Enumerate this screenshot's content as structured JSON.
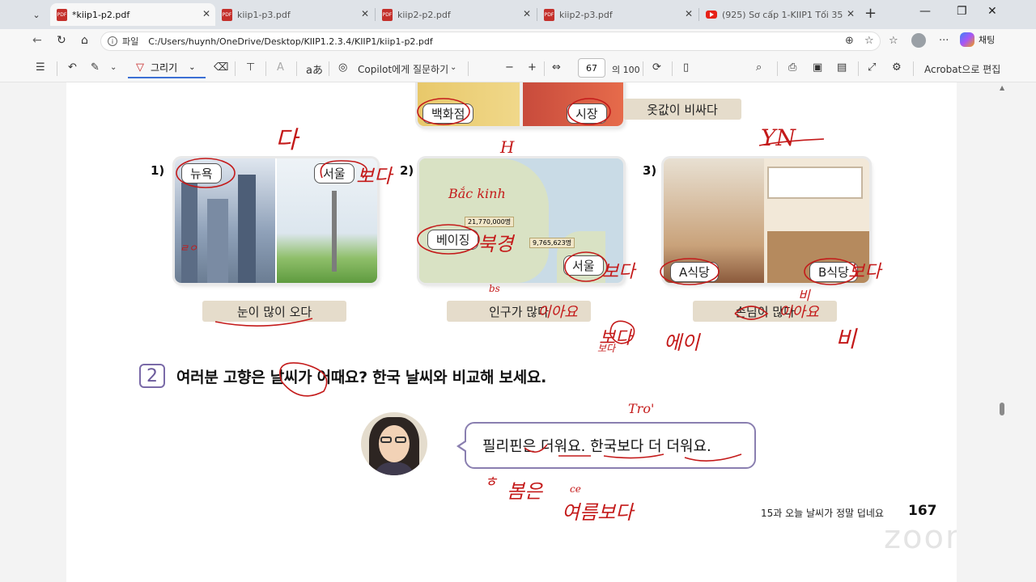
{
  "tabs": [
    {
      "title": "*kiip1-p2.pdf",
      "active": true
    },
    {
      "title": "kiip1-p3.pdf"
    },
    {
      "title": "kiip2-p2.pdf"
    },
    {
      "title": "kiip2-p3.pdf"
    },
    {
      "title": "(925) Sơ cấp 1-KIIP1 Tối 357 T12.2..."
    }
  ],
  "address": {
    "scheme_label": "파일",
    "path": "C:/Users/huynh/OneDrive/Desktop/KIIP1.2.3.4/KIIP1/kiip1-p2.pdf"
  },
  "browser": {
    "copilot_label": "채팅"
  },
  "pdf_toolbar": {
    "draw_label": "그리기",
    "copilot_ask": "Copilot에게 질문하기",
    "page_current": "67",
    "page_total": "의 100",
    "acrobat_label": "Acrobat으로 편집"
  },
  "page": {
    "top_tag_left": "백화점",
    "top_tag_right": "시장",
    "top_caption": "옷값이 비싸다",
    "items": [
      {
        "num": "1)",
        "left_tag": "뉴욕",
        "right_tag": "서울",
        "caption": "눈이 많이 오다"
      },
      {
        "num": "2)",
        "left_tag": "베이징",
        "right_tag": "서울",
        "caption": "인구가 많다",
        "figure_a": "21,770,000명",
        "figure_b": "9,765,623명"
      },
      {
        "num": "3)",
        "left_tag": "A식당",
        "right_tag": "B식당",
        "caption": "손님이 많다"
      }
    ],
    "question_num": "2",
    "question": "여러분 고향은 날씨가 어때요? 한국 날씨와 비교해 보세요.",
    "speech": "필리핀은 더워요. 한국보다 더 더워요.",
    "footer_title": "15과 오늘 날씨가 정말 덥네요",
    "footer_page": "167",
    "watermark": "zoom"
  },
  "annotations": {
    "a1": "다",
    "a2": "보다",
    "a3": "H",
    "a4": "Bắc kinh",
    "a5": "북경",
    "a6": "보다",
    "a7": "bs",
    "a8": "보다",
    "a9": "에이",
    "a10": "YN",
    "a11": "보다",
    "a12": "비",
    "a13": "비",
    "a14": "보다",
    "a15": "Tro'",
    "a16": "봄은",
    "a17": "여름보다",
    "a18": "ㅎ",
    "a19": "ㄹㅇ",
    "a20": "ce",
    "a21": "이아요",
    "a22": "이아요"
  }
}
